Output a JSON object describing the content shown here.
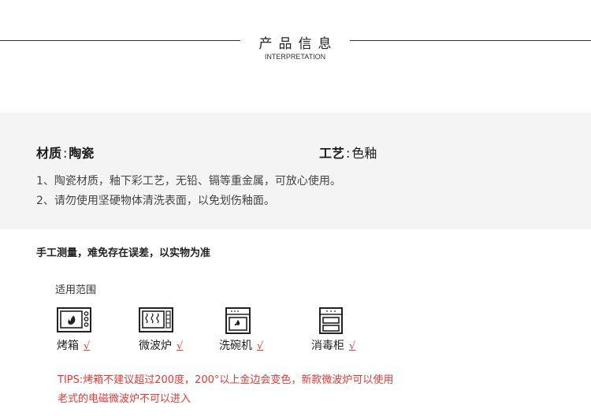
{
  "header": {
    "title": "产品信息",
    "subtitle": "INTERPRETATION"
  },
  "info": {
    "material_label": "材质",
    "material_value": "陶瓷",
    "craft_label": "工艺",
    "craft_value": "色釉",
    "notes": [
      "1、陶瓷材质，釉下彩工艺，无铅、镉等重金属，可放心使用。",
      "2、请勿使用坚硬物体清洗表面，以免划伤釉面。"
    ]
  },
  "measure_note": "手工测量，难免存在误差，以实物为准",
  "scope": {
    "title": "适用范围",
    "items": [
      {
        "label": "烤箱",
        "check": "√",
        "icon": "oven-icon"
      },
      {
        "label": "微波炉",
        "check": "√",
        "icon": "microwave-icon"
      },
      {
        "label": "洗碗机",
        "check": "√",
        "icon": "dishwasher-icon"
      },
      {
        "label": "消毒柜",
        "check": "√",
        "icon": "sterilizer-cabinet-icon"
      }
    ]
  },
  "tips": [
    "TIPS:烤箱不建议超过200度，200°以上金边会变色，新款微波炉可以使用",
    "老式的电磁微波炉不可以进入"
  ],
  "colors": {
    "tips": "#e53935",
    "band": "#f4f4f4"
  }
}
